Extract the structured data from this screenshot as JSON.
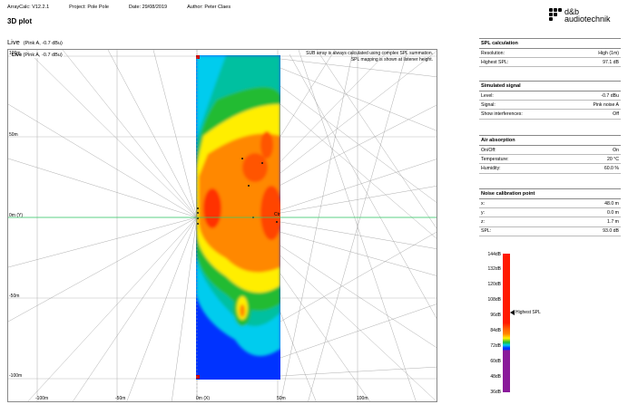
{
  "header": {
    "app": "ArrayCalc: V12.2.1",
    "project": "Project: Pole Pole",
    "date": "Date: 29/08/2019",
    "author": "Author: Peter Claes"
  },
  "logo": {
    "line1": "d&b",
    "line2": "audiotechnik"
  },
  "page_title": "3D plot",
  "plot": {
    "live_label": "Live",
    "live_sub": "(Pink A, -0.7 dBu)",
    "note_line1": "SUB array is always calculated using complex SPL summation.",
    "note_line2": "SPL mapping is shown at listener height.",
    "y_ticks": [
      "100m",
      "50m",
      "0m (Y)",
      "-50m",
      "-100m"
    ],
    "x_ticks": [
      "-100m",
      "-50m",
      "0m (X)",
      "50m",
      "100m"
    ],
    "center_label": "Ctr"
  },
  "panels": [
    {
      "title": "SPL calculation",
      "rows": [
        [
          "Resolution:",
          "High (1m)"
        ],
        [
          "Highest SPL:",
          "97.1 dB"
        ]
      ]
    },
    {
      "title": "Simulated signal",
      "rows": [
        [
          "Level:",
          "-0.7 dBu"
        ],
        [
          "Signal:",
          "Pink noise A"
        ],
        [
          "Show interferences:",
          "Off"
        ]
      ]
    },
    {
      "title": "Air absorption",
      "rows": [
        [
          "On/Off:",
          "On"
        ],
        [
          "Temperature:",
          "20 °C"
        ],
        [
          "Humidity:",
          "60.0 %"
        ]
      ]
    },
    {
      "title": "Noise calibration point",
      "rows": [
        [
          "x:",
          "48.0 m"
        ],
        [
          "y:",
          "0.0 m"
        ],
        [
          "z:",
          "1.7 m"
        ],
        [
          "SPL:",
          "93.0 dB"
        ]
      ]
    }
  ],
  "scale": {
    "labels": [
      "144dB",
      "132dB",
      "120dB",
      "108dB",
      "96dB",
      "84dB",
      "72dB",
      "60dB",
      "48dB",
      "36dB"
    ],
    "marker_label": "Highest SPL",
    "marker_value": 97.1,
    "min": 36,
    "max": 144,
    "colors": {
      "red": "#ff1a00",
      "orange": "#ff8800",
      "yellow": "#ffee00",
      "green": "#22bb33",
      "cyan": "#00ccee",
      "blue": "#0033ff",
      "purple": "#8a1a9a"
    }
  }
}
